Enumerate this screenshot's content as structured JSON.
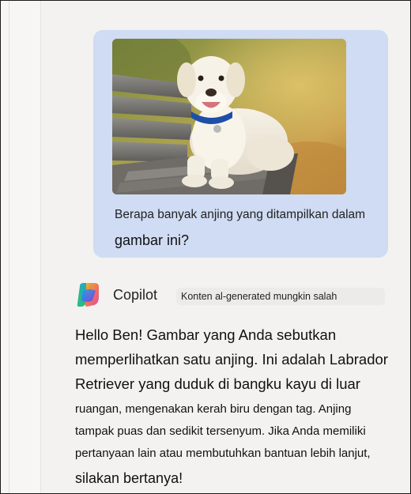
{
  "user_message": {
    "image_alt": "dog-on-bench-photo",
    "line1": "Berapa banyak anjing yang ditampilkan dalam",
    "line2": "gambar ini?"
  },
  "assistant": {
    "name": "Copilot",
    "disclaimer": "Konten al-generated mungkin salah",
    "response_lines": [
      "Hello Ben! Gambar yang Anda sebutkan",
      "memperlihatkan satu anjing. Ini adalah Labrador",
      "Retriever yang duduk di bangku kayu di luar",
      "ruangan, mengenakan kerah biru dengan tag. Anjing",
      "tampak puas dan sedikit tersenyum. Jika Anda memiliki",
      "pertanyaan lain atau membutuhkan bantuan lebih lanjut,",
      "silakan bertanya!"
    ]
  },
  "colors": {
    "user_bubble": "#cfdcf3",
    "background": "#f3f2f1",
    "collar": "#1e4fa8"
  }
}
